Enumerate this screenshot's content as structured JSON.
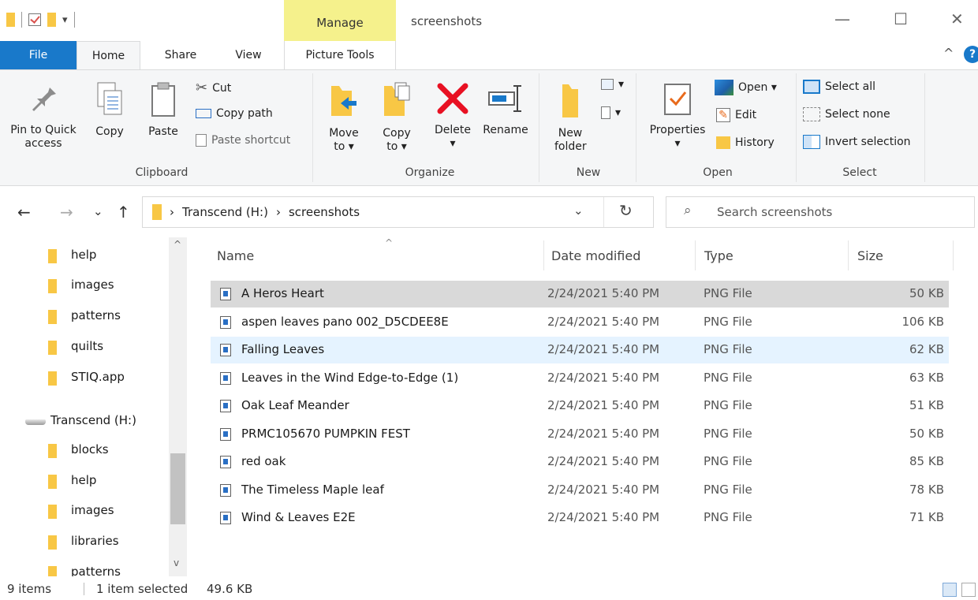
{
  "window": {
    "title": "screenshots",
    "context_tab": "Manage",
    "controls": {
      "minimize": "—",
      "maximize": "☐",
      "close": "✕"
    }
  },
  "quick_access": {
    "dropdown_glyph": "▾"
  },
  "ribbon_tabs": {
    "file": "File",
    "home": "Home",
    "share": "Share",
    "view": "View",
    "picture_tools": "Picture Tools",
    "collapse_glyph": "^",
    "help_glyph": "?"
  },
  "ribbon": {
    "clipboard": {
      "label": "Clipboard",
      "pin": "Pin to Quick access",
      "copy": "Copy",
      "paste": "Paste",
      "cut": "Cut",
      "copy_path": "Copy path",
      "paste_shortcut": "Paste shortcut"
    },
    "organize": {
      "label": "Organize",
      "move_to": "Move to ▾",
      "copy_to": "Copy to ▾",
      "delete": "Delete",
      "delete_dd": "▾",
      "rename": "Rename"
    },
    "new": {
      "label": "New",
      "new_folder": "New folder",
      "dd": "▾"
    },
    "open": {
      "label": "Open",
      "properties": "Properties",
      "properties_dd": "▾",
      "open": "Open ▾",
      "edit": "Edit",
      "history": "History"
    },
    "select": {
      "label": "Select",
      "select_all": "Select all",
      "select_none": "Select none",
      "invert": "Invert selection"
    }
  },
  "nav": {
    "back": "←",
    "forward": "→",
    "recent": "⌄",
    "up": "↑",
    "breadcrumb": [
      "Transcend (H:)",
      "screenshots"
    ],
    "sep": "›",
    "dropdown": "⌄",
    "refresh": "↻"
  },
  "search": {
    "placeholder": "Search screenshots",
    "glyph": "⌕"
  },
  "nav_pane": {
    "items": [
      {
        "label": "help",
        "kind": "folder"
      },
      {
        "label": "images",
        "kind": "folder"
      },
      {
        "label": "patterns",
        "kind": "folder"
      },
      {
        "label": "quilts",
        "kind": "folder"
      },
      {
        "label": "STIQ.app",
        "kind": "folder"
      },
      {
        "label": "Transcend (H:)",
        "kind": "drive"
      },
      {
        "label": "blocks",
        "kind": "folder"
      },
      {
        "label": "help",
        "kind": "folder"
      },
      {
        "label": "images",
        "kind": "folder"
      },
      {
        "label": "libraries",
        "kind": "folder"
      },
      {
        "label": "patterns",
        "kind": "folder"
      }
    ],
    "scroll_up": "^",
    "scroll_down": "v"
  },
  "columns": {
    "name": "Name",
    "date": "Date modified",
    "type": "Type",
    "size": "Size",
    "sort_glyph": "^"
  },
  "files": [
    {
      "name": "A Heros Heart",
      "date": "2/24/2021 5:40 PM",
      "type": "PNG File",
      "size": "50 KB",
      "state": "selected"
    },
    {
      "name": "aspen leaves pano 002_D5CDEE8E",
      "date": "2/24/2021 5:40 PM",
      "type": "PNG File",
      "size": "106 KB",
      "state": ""
    },
    {
      "name": "Falling Leaves",
      "date": "2/24/2021 5:40 PM",
      "type": "PNG File",
      "size": "62 KB",
      "state": "hover"
    },
    {
      "name": "Leaves in the Wind Edge-to-Edge (1)",
      "date": "2/24/2021 5:40 PM",
      "type": "PNG File",
      "size": "63 KB",
      "state": ""
    },
    {
      "name": "Oak Leaf Meander",
      "date": "2/24/2021 5:40 PM",
      "type": "PNG File",
      "size": "51 KB",
      "state": ""
    },
    {
      "name": "PRMC105670 PUMPKIN FEST",
      "date": "2/24/2021 5:40 PM",
      "type": "PNG File",
      "size": "50 KB",
      "state": ""
    },
    {
      "name": "red oak",
      "date": "2/24/2021 5:40 PM",
      "type": "PNG File",
      "size": "85 KB",
      "state": ""
    },
    {
      "name": "The Timeless Maple leaf",
      "date": "2/24/2021 5:40 PM",
      "type": "PNG File",
      "size": "78 KB",
      "state": ""
    },
    {
      "name": "Wind & Leaves E2E",
      "date": "2/24/2021 5:40 PM",
      "type": "PNG File",
      "size": "71 KB",
      "state": ""
    }
  ],
  "status": {
    "items": "9 items",
    "selected": "1 item selected",
    "size": "49.6 KB"
  },
  "colors": {
    "accent": "#1979ca",
    "folder": "#f8c745",
    "manage_tab": "#f5f18c",
    "delete_red": "#e81123",
    "selected_row": "#d9d9d9",
    "hover_row": "#e5f3ff"
  }
}
